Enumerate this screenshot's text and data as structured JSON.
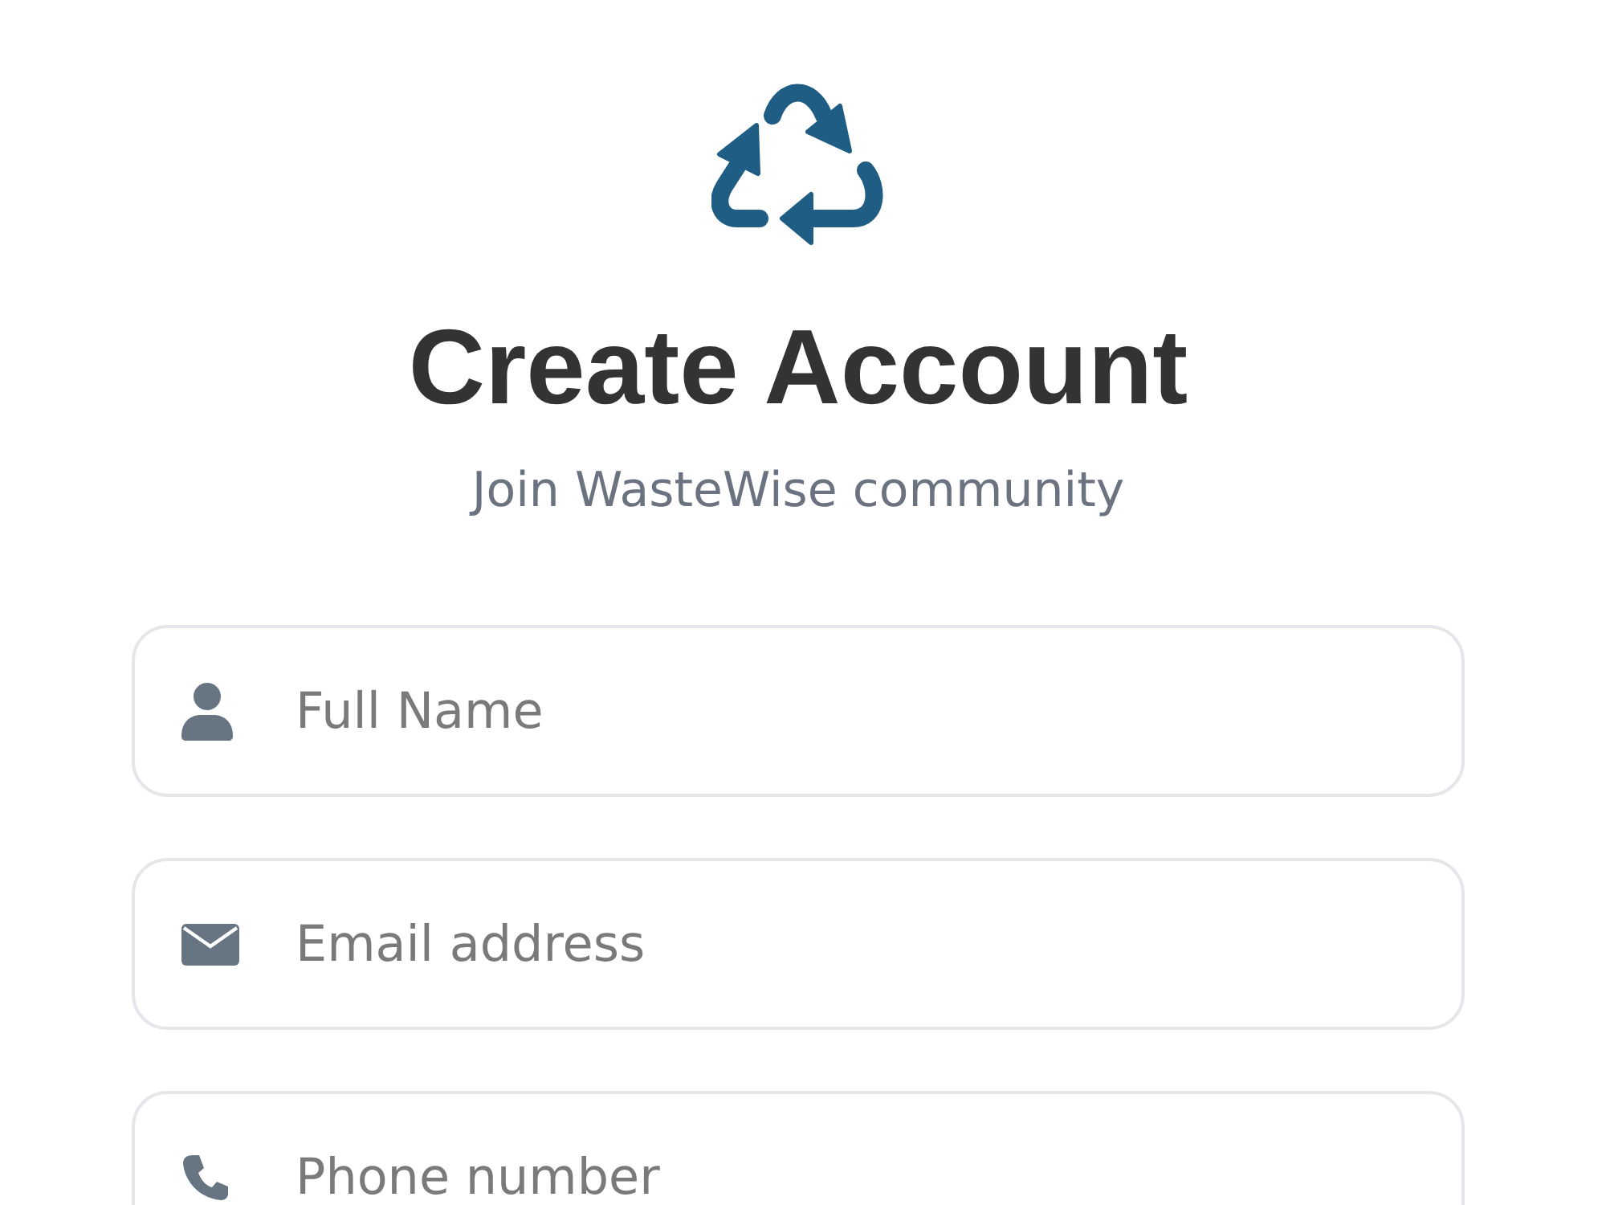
{
  "header": {
    "title": "Create Account",
    "subtitle": "Join WasteWise community"
  },
  "fields": [
    {
      "kind": "name",
      "placeholder": "Full Name"
    },
    {
      "kind": "email",
      "placeholder": "Email address"
    },
    {
      "kind": "phone",
      "placeholder": "Phone number"
    }
  ]
}
